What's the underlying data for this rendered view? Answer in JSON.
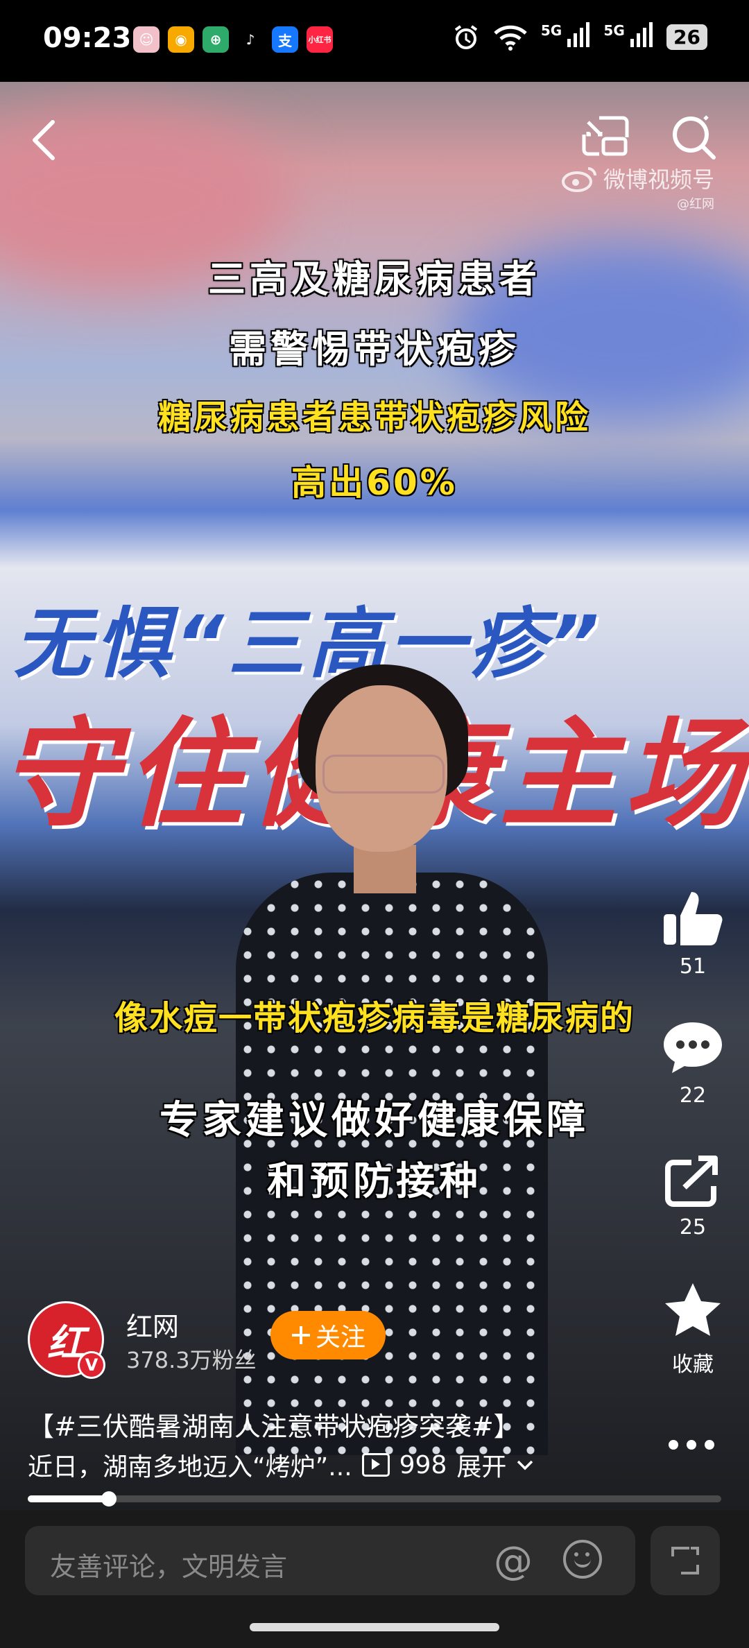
{
  "status_bar": {
    "time": "09:23",
    "apps": [
      {
        "icon": "avatar-app-icon",
        "color": "#f2c0c9",
        "glyph": "☺"
      },
      {
        "icon": "weibo-icon",
        "color": "#f7a900",
        "glyph": "◉"
      },
      {
        "icon": "bank-icon",
        "color": "#2eaa6a",
        "glyph": "⊕"
      },
      {
        "icon": "tiktok-icon",
        "color": "#000000",
        "glyph": "♪"
      },
      {
        "icon": "alipay-icon",
        "color": "#1677ff",
        "glyph": "支"
      },
      {
        "icon": "xiaohongshu-icon",
        "color": "#ff2442",
        "glyph": "小红书"
      }
    ],
    "signal1": "5G",
    "signal2": "5G",
    "battery": "26"
  },
  "video": {
    "watermark_brand": "微博视频号",
    "watermark_handle": "@红网",
    "caption_line1": "三高及糖尿病患者",
    "caption_line2": "需警惕带状疱疹",
    "caption_yellow1": "糖尿病患者患带状疱疹风险",
    "caption_yellow2": "高出60%",
    "bg_title_1": "无惧“三高一疹”",
    "bg_title_2": "守住健康主场",
    "subtitle": "像水痘一带状疱疹病毒是糖尿病的",
    "caption_bottom1": "专家建议做好健康保障",
    "caption_bottom2": "和预防接种"
  },
  "actions": {
    "like_count": "51",
    "comment_count": "22",
    "share_count": "25",
    "favorite_label": "收藏"
  },
  "author": {
    "avatar_glyph": "红",
    "verified_glyph": "V",
    "name": "红网",
    "fans": "378.3万粉丝",
    "follow_label": "关注"
  },
  "description": {
    "title": "【#三伏酷暑湖南人注意带状疱疹突袭#】",
    "text": "近日，湖南多地迈入“烤炉”...",
    "play_count": "998",
    "expand_label": "展开"
  },
  "progress": {
    "fraction": 0.117
  },
  "comment": {
    "placeholder": "友善评论，文明发言",
    "at_symbol": "@"
  }
}
